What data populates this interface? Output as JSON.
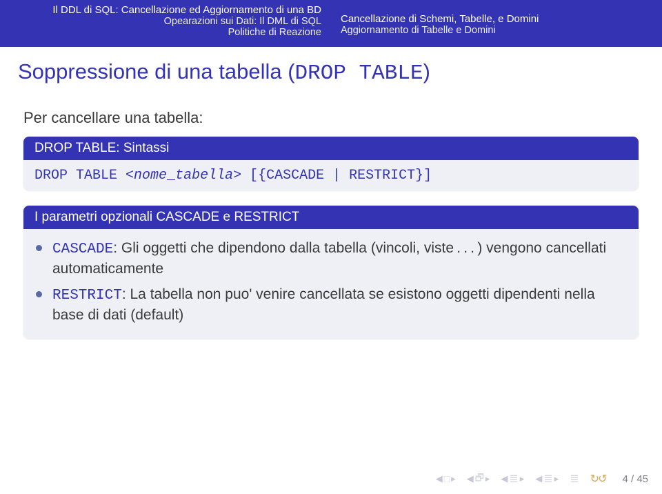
{
  "header": {
    "left": {
      "line1": "Il DDL di SQL: Cancellazione ed Aggiornamento di una BD",
      "line2": "Opearazioni sui Dati: Il DML di SQL",
      "line3": "Politiche di Reazione"
    },
    "right": {
      "line1": "Cancellazione di Schemi, Tabelle, e Domini",
      "line2": "Aggiornamento di Tabelle e Domini"
    }
  },
  "title": {
    "prefix": "Soppressione di una tabella (",
    "code": "DROP TABLE",
    "suffix": ")"
  },
  "intro": "Per cancellare una tabella:",
  "block1": {
    "title": "DROP TABLE: Sintassi",
    "code_prefix": "DROP TABLE ",
    "code_arg1": "<nome",
    "code_sep": "_",
    "code_arg2": "tabella>",
    "code_tail": " [{CASCADE | RESTRICT}]"
  },
  "block2": {
    "title": "I parametri opzionali CASCADE e RESTRICT",
    "bullet1_code": "CASCADE",
    "bullet1_text": ": Gli oggetti che dipendono dalla tabella (vincoli, viste . . . ) vengono cancellati automaticamente",
    "bullet2_code": "RESTRICT",
    "bullet2_text": ": La tabella non puo' venire cancellata se esistono oggetti dipendenti nella base di dati (default)"
  },
  "footer": {
    "page": "4 / 45"
  }
}
